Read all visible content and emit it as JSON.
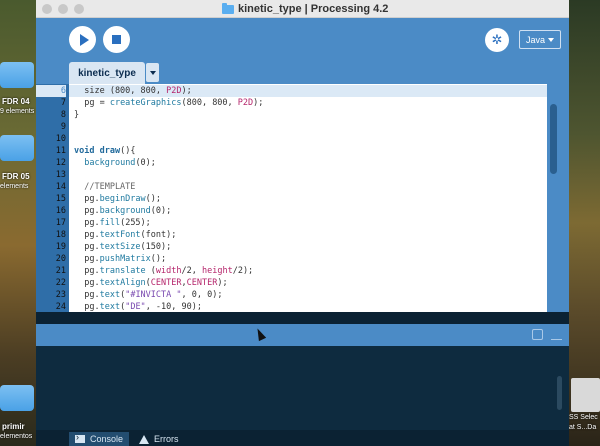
{
  "window": {
    "title": "kinetic_type | Processing 4.2"
  },
  "toolbar": {
    "mode_label": "Java"
  },
  "tabs": [
    {
      "label": "kinetic_type"
    }
  ],
  "editor": {
    "lines": [
      {
        "num": "6",
        "current": true,
        "tokens": [
          [
            "",
            "  size (800, 800, "
          ],
          [
            "cn",
            "P2D"
          ],
          [
            "",
            ");"
          ]
        ]
      },
      {
        "num": "7",
        "current": false,
        "tokens": [
          [
            "",
            "  pg = "
          ],
          [
            "fn",
            "createGraphics"
          ],
          [
            "",
            "(800, 800, "
          ],
          [
            "cn",
            "P2D"
          ],
          [
            "",
            ");"
          ]
        ]
      },
      {
        "num": "8",
        "current": false,
        "tokens": [
          [
            "",
            "}"
          ]
        ]
      },
      {
        "num": "9",
        "current": false,
        "tokens": []
      },
      {
        "num": "10",
        "current": false,
        "tokens": []
      },
      {
        "num": "11",
        "current": false,
        "tokens": [
          [
            "kw",
            "void"
          ],
          [
            "",
            " "
          ],
          [
            "kw",
            "draw"
          ],
          [
            "",
            "(){"
          ]
        ]
      },
      {
        "num": "12",
        "current": false,
        "tokens": [
          [
            "",
            "  "
          ],
          [
            "fn",
            "background"
          ],
          [
            "",
            "(0);"
          ]
        ]
      },
      {
        "num": "13",
        "current": false,
        "tokens": []
      },
      {
        "num": "14",
        "current": false,
        "tokens": [
          [
            "cm",
            "  //TEMPLATE"
          ]
        ]
      },
      {
        "num": "15",
        "current": false,
        "tokens": [
          [
            "",
            "  pg."
          ],
          [
            "fn",
            "beginDraw"
          ],
          [
            "",
            "();"
          ]
        ]
      },
      {
        "num": "16",
        "current": false,
        "tokens": [
          [
            "",
            "  pg."
          ],
          [
            "fn",
            "background"
          ],
          [
            "",
            "(0);"
          ]
        ]
      },
      {
        "num": "17",
        "current": false,
        "tokens": [
          [
            "",
            "  pg."
          ],
          [
            "fn",
            "fill"
          ],
          [
            "",
            "(255);"
          ]
        ]
      },
      {
        "num": "18",
        "current": false,
        "tokens": [
          [
            "",
            "  pg."
          ],
          [
            "fn",
            "textFont"
          ],
          [
            "",
            "(font);"
          ]
        ]
      },
      {
        "num": "19",
        "current": false,
        "tokens": [
          [
            "",
            "  pg."
          ],
          [
            "fn",
            "textSize"
          ],
          [
            "",
            "(150);"
          ]
        ]
      },
      {
        "num": "20",
        "current": false,
        "tokens": [
          [
            "",
            "  pg."
          ],
          [
            "fn",
            "pushMatrix"
          ],
          [
            "",
            "();"
          ]
        ]
      },
      {
        "num": "21",
        "current": false,
        "tokens": [
          [
            "",
            "  pg."
          ],
          [
            "fn",
            "translate"
          ],
          [
            "",
            " ("
          ],
          [
            "cn",
            "width"
          ],
          [
            "",
            "/2, "
          ],
          [
            "cn",
            "height"
          ],
          [
            "",
            "/2);"
          ]
        ]
      },
      {
        "num": "22",
        "current": false,
        "tokens": [
          [
            "",
            "  pg."
          ],
          [
            "fn",
            "textAlign"
          ],
          [
            "",
            "("
          ],
          [
            "cn",
            "CENTER"
          ],
          [
            "",
            ","
          ],
          [
            "cn",
            "CENTER"
          ],
          [
            "",
            ");"
          ]
        ]
      },
      {
        "num": "23",
        "current": false,
        "tokens": [
          [
            "",
            "  pg."
          ],
          [
            "fn",
            "text"
          ],
          [
            "",
            "("
          ],
          [
            "st",
            "\"#INVICTA \""
          ],
          [
            "",
            ", 0, 0);"
          ]
        ]
      },
      {
        "num": "24",
        "current": false,
        "tokens": [
          [
            "",
            "  pg."
          ],
          [
            "fn",
            "text"
          ],
          [
            "",
            "("
          ],
          [
            "st",
            "\"DE\""
          ],
          [
            "",
            ", -10, 90);"
          ]
        ]
      }
    ]
  },
  "console": {
    "tab_console": "Console",
    "tab_errors": "Errors"
  },
  "desktop": {
    "items": [
      {
        "label": "FDR 04",
        "sub": "9 elements"
      },
      {
        "label": "FDR 05",
        "sub": "elements"
      },
      {
        "label": "primir",
        "sub": "elementos"
      }
    ],
    "right_label_1": "SS Selec",
    "right_label_2": "at S...Da"
  },
  "colors": {
    "accent": "#4b8bc6",
    "console_bg": "#0e2b3f",
    "current_line": "#dbe9f6"
  },
  "icons": [
    "play-icon",
    "stop-icon",
    "debug-icon",
    "folder-icon",
    "console-icon",
    "warning-icon"
  ]
}
